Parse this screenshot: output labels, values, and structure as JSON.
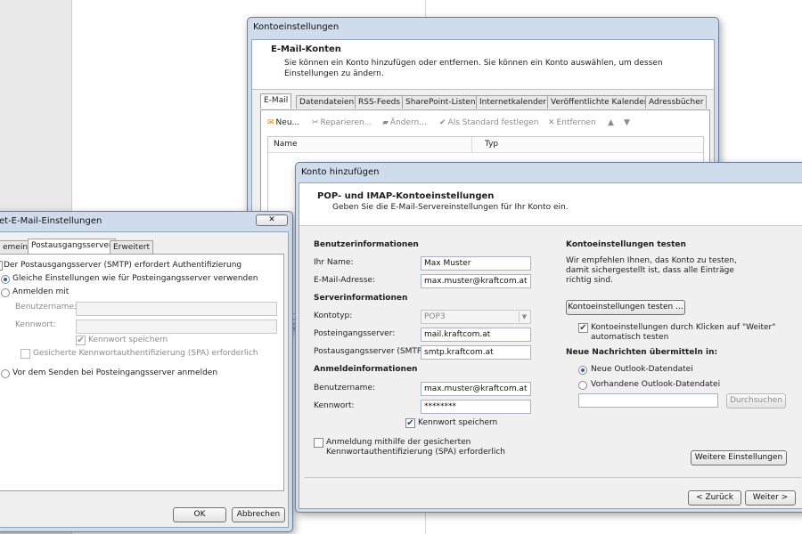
{
  "konto": {
    "title": "Kontoeinstellungen",
    "header_title": "E-Mail-Konten",
    "header_desc": "Sie können ein Konto hinzufügen oder entfernen. Sie können ein Konto auswählen, um dessen Einstellungen zu ändern.",
    "tabs": [
      "E-Mail",
      "Datendateien",
      "RSS-Feeds",
      "SharePoint-Listen",
      "Internetkalender",
      "Veröffentlichte Kalender",
      "Adressbücher"
    ],
    "toolbar": {
      "new": "Neu...",
      "repair": "Reparieren...",
      "change": "Ändern...",
      "default": "Als Standard festlegen",
      "remove": "Entfernen"
    },
    "columns": [
      "Name",
      "Typ"
    ]
  },
  "internet": {
    "title": "et-E-Mail-Einstellungen",
    "tabs": [
      "emein",
      "Postausgangsserver",
      "Erweitert"
    ],
    "smtp_auth": "Der Postausgangsserver (SMTP) erfordert Authentifizierung",
    "same_settings": "Gleiche Einstellungen wie für Posteingangsserver verwenden",
    "login_with": "Anmelden mit",
    "username_label": "Benutzername:",
    "password_label": "Kennwort:",
    "save_password": "Kennwort speichern",
    "spa": "Gesicherte Kennwortauthentifizierung (SPA) erforderlich",
    "login_before_send": "Vor dem Senden bei Posteingangsserver anmelden",
    "ok": "OK",
    "cancel": "Abbrechen"
  },
  "add": {
    "title": "Konto hinzufügen",
    "header_title": "POP- und IMAP-Kontoeinstellungen",
    "header_desc": "Geben Sie die E-Mail-Servereinstellungen für Ihr Konto ein.",
    "user_info": "Benutzerinformationen",
    "name_label": "Ihr Name:",
    "name_value": "Max Muster",
    "email_label": "E-Mail-Adresse:",
    "email_value": "max.muster@kraftcom.at",
    "server_info": "Serverinformationen",
    "type_label": "Kontotyp:",
    "type_value": "POP3",
    "incoming_label": "Posteingangsserver:",
    "incoming_value": "mail.kraftcom.at",
    "outgoing_label": "Postausgangsserver (SMTP):",
    "outgoing_value": "smtp.kraftcom.at",
    "login_info": "Anmeldeinformationen",
    "user_label": "Benutzername:",
    "user_value": "max.muster@kraftcom.at",
    "pw_label": "Kennwort:",
    "pw_value": "********",
    "save_pw": "Kennwort speichern",
    "spa": "Anmeldung mithilfe der gesicherten Kennwortauthentifizierung (SPA) erforderlich",
    "test_title": "Kontoeinstellungen testen",
    "test_desc": "Wir empfehlen Ihnen, das Konto zu testen, damit sichergestellt ist, dass alle Einträge richtig sind.",
    "test_button": "Kontoeinstellungen testen ...",
    "auto_test": "Kontoeinstellungen durch Klicken auf \"Weiter\" automatisch testen",
    "deliver_title": "Neue Nachrichten übermitteln in:",
    "new_datafile": "Neue Outlook-Datendatei",
    "existing_datafile": "Vorhandene Outlook-Datendatei",
    "browse": "Durchsuchen",
    "more_settings": "Weitere Einstellungen",
    "back": "< Zurück",
    "next": "Weiter >"
  }
}
